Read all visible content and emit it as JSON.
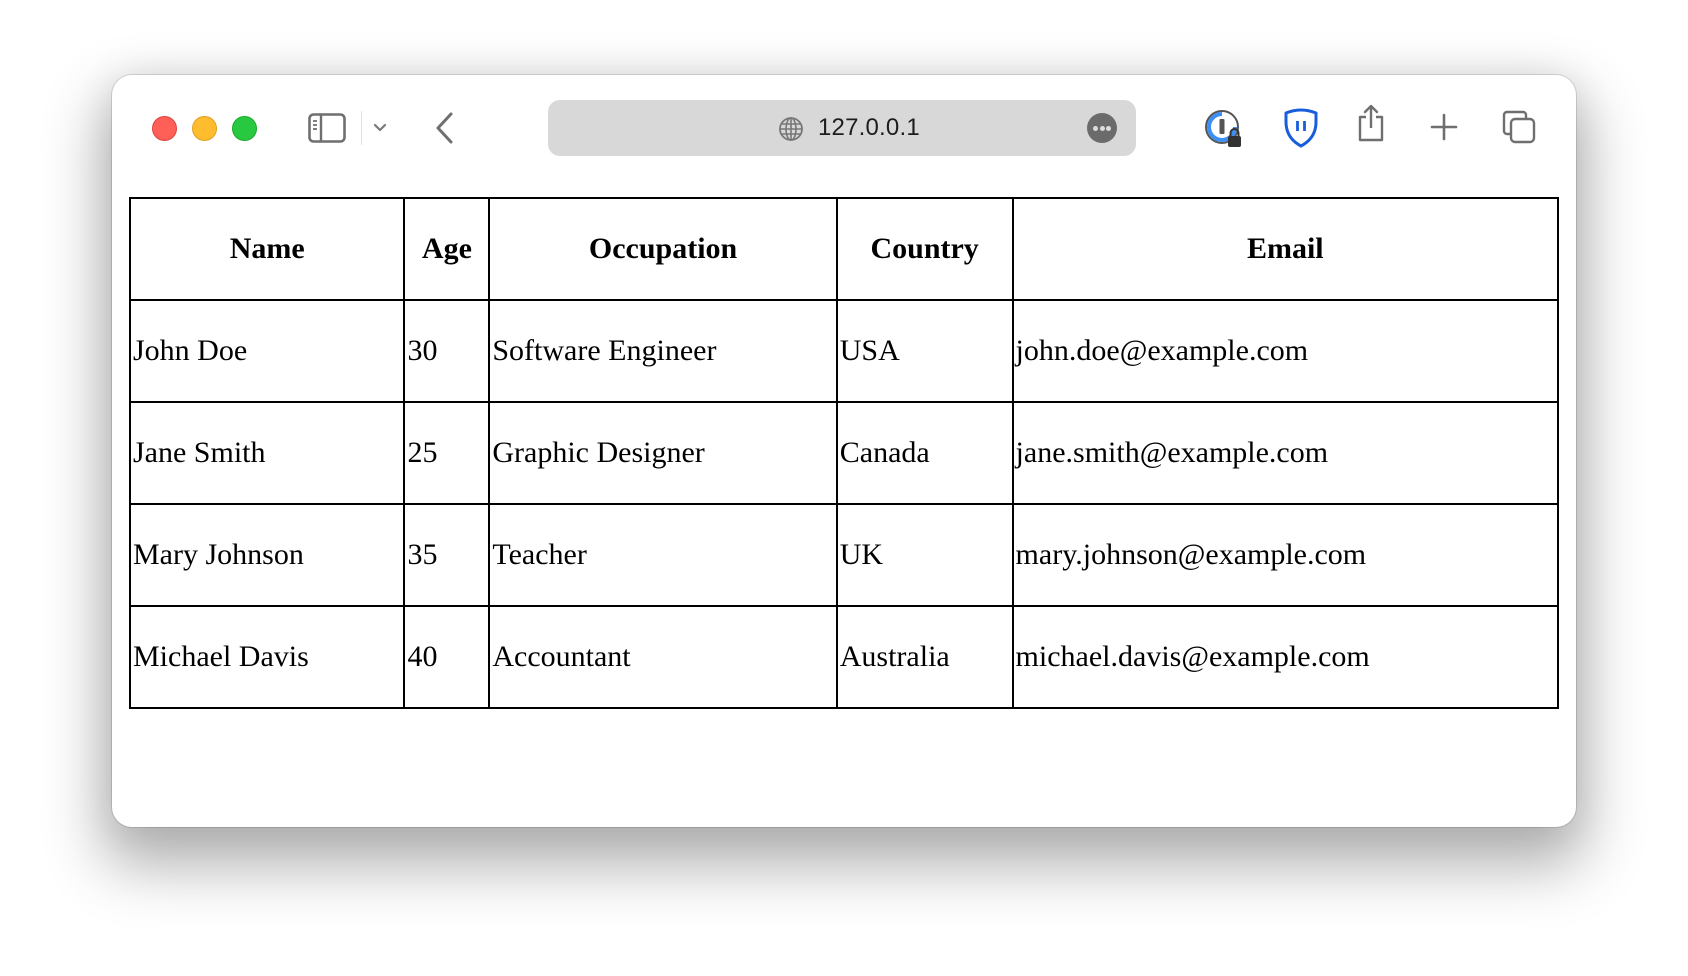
{
  "browser": {
    "address_bar": {
      "url": "127.0.0.1"
    },
    "toolbar_icons": [
      "sidebar-toggle-icon",
      "chevron-down-icon",
      "back-icon",
      "globe-icon",
      "more-icon",
      "password-manager-icon",
      "bitwarden-shield-icon",
      "share-icon",
      "new-tab-plus-icon",
      "tab-overview-icon"
    ],
    "colors": {
      "close": "#fe5f57",
      "minimize": "#febc2e",
      "maximize": "#28c840",
      "shield": "#175ddc",
      "password_ring": "#3b8ff5"
    }
  },
  "table": {
    "headers": [
      "Name",
      "Age",
      "Occupation",
      "Country",
      "Email"
    ],
    "rows": [
      [
        "John Doe",
        "30",
        "Software Engineer",
        "USA",
        "john.doe@example.com"
      ],
      [
        "Jane Smith",
        "25",
        "Graphic Designer",
        "Canada",
        "jane.smith@example.com"
      ],
      [
        "Mary Johnson",
        "35",
        "Teacher",
        "UK",
        "mary.johnson@example.com"
      ],
      [
        "Michael Davis",
        "40",
        "Accountant",
        "Australia",
        "michael.davis@example.com"
      ]
    ]
  }
}
